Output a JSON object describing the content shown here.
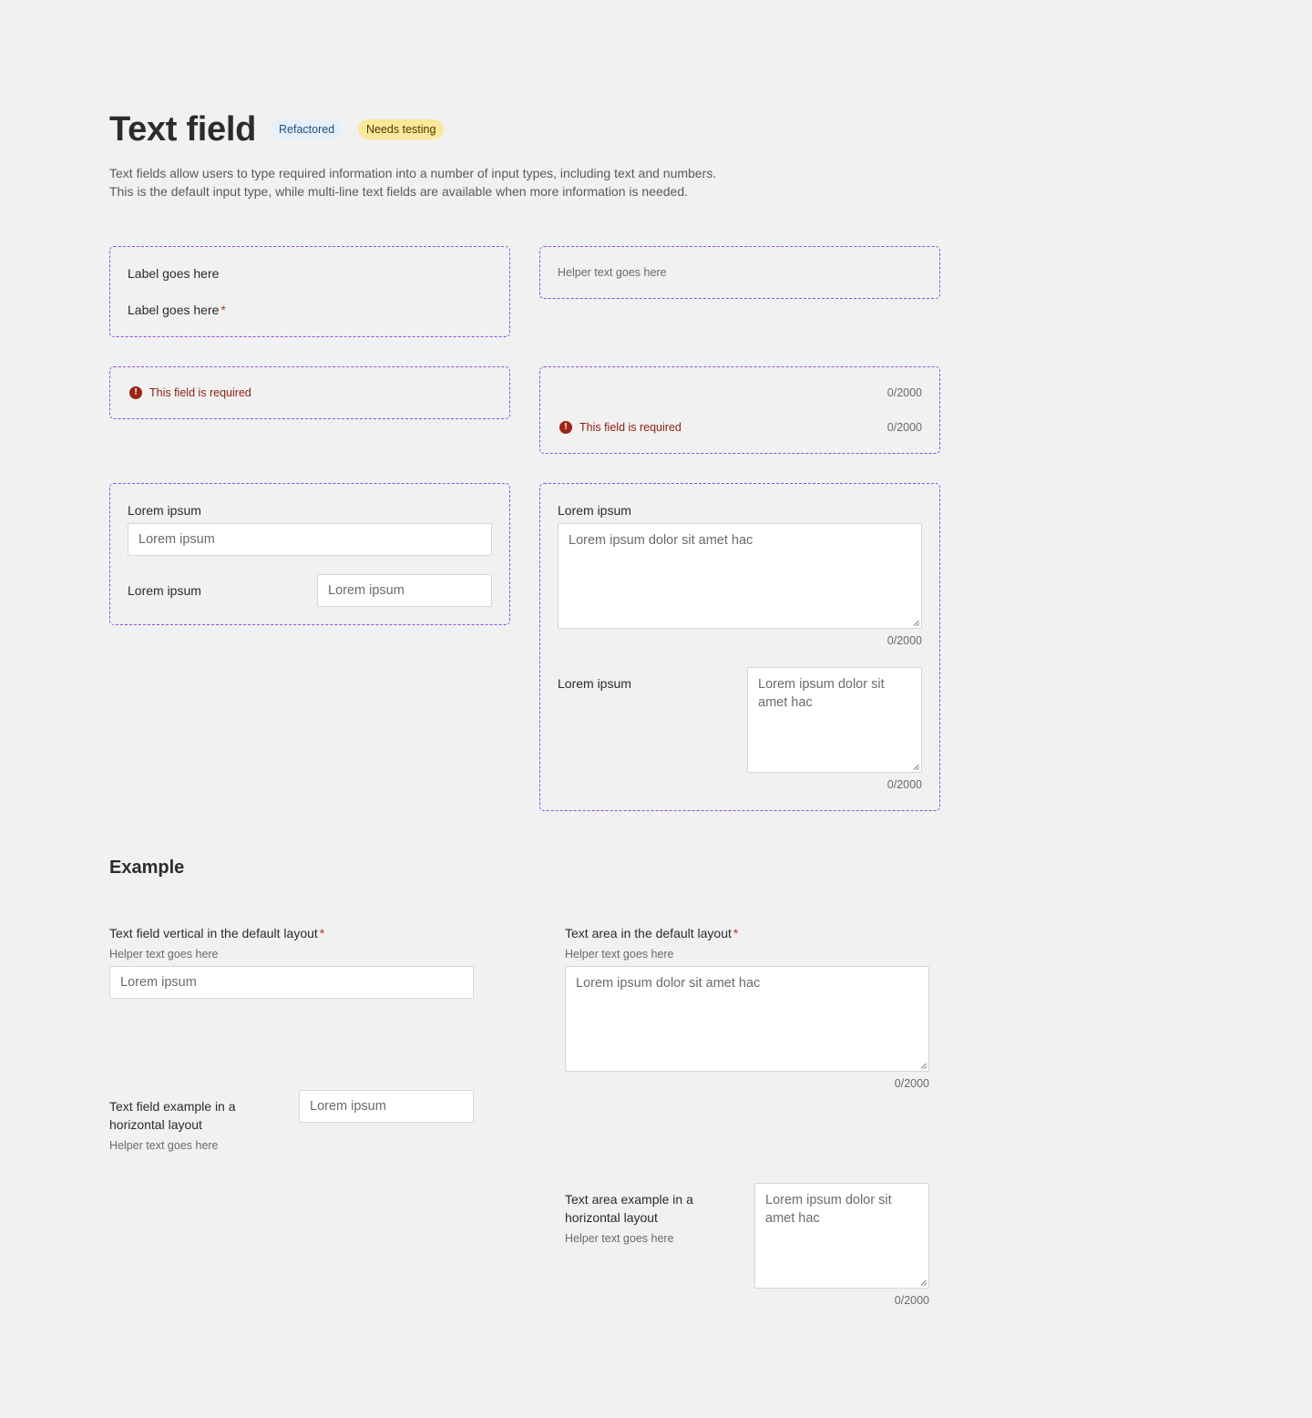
{
  "header": {
    "title": "Text field",
    "badges": [
      "Refactored",
      "Needs testing"
    ],
    "description_line1": "Text fields allow users to type required information into a number of input types, including text and numbers.",
    "description_line2": "This is the default input type, while multi-line text fields are available when more information is needed."
  },
  "specimens": {
    "labels": {
      "label": "Label goes here",
      "label_required": "Label goes here",
      "required_marker": "*"
    },
    "helper": {
      "text": "Helper text goes here"
    },
    "error": {
      "icon": "!",
      "text": "This field is required"
    },
    "counters": {
      "counter_only": "0/2000",
      "error_text": "This field is required",
      "error_counter": "0/2000",
      "icon": "!"
    },
    "text_fields": {
      "vertical_label": "Lorem ipsum",
      "vertical_value": "Lorem ipsum",
      "horizontal_label": "Lorem ipsum",
      "horizontal_value": "Lorem ipsum"
    },
    "text_areas": {
      "vertical_label": "Lorem ipsum",
      "vertical_value": "Lorem ipsum dolor sit amet hac",
      "vertical_counter": "0/2000",
      "horizontal_label": "Lorem ipsum",
      "horizontal_value": "Lorem ipsum dolor sit amet hac",
      "horizontal_counter": "0/2000"
    }
  },
  "example": {
    "heading": "Example",
    "tf_vertical": {
      "label": "Text field vertical in the default layout",
      "required": "*",
      "helper": "Helper text goes here",
      "value": "Lorem ipsum"
    },
    "ta_vertical": {
      "label": "Text area in the default layout",
      "required": "*",
      "helper": "Helper text goes here",
      "value": "Lorem ipsum dolor sit amet hac",
      "counter": "0/2000"
    },
    "tf_horizontal": {
      "label_line1": "Text field example in a",
      "label_line2": "horizontal layout",
      "helper": "Helper text goes here",
      "value": "Lorem ipsum"
    },
    "ta_horizontal": {
      "label_line1": "Text area example in a",
      "label_line2": "horizontal layout",
      "helper": "Helper text goes here",
      "value": "Lorem ipsum dolor sit amet hac",
      "counter": "0/2000"
    }
  },
  "colors": {
    "background": "#f1f1f1",
    "dashed_border": "#8a50e8",
    "error": "#8b1f12",
    "required": "#b0391e",
    "badge_blue": "#e5f0fa",
    "badge_yellow": "#fbe89b"
  }
}
